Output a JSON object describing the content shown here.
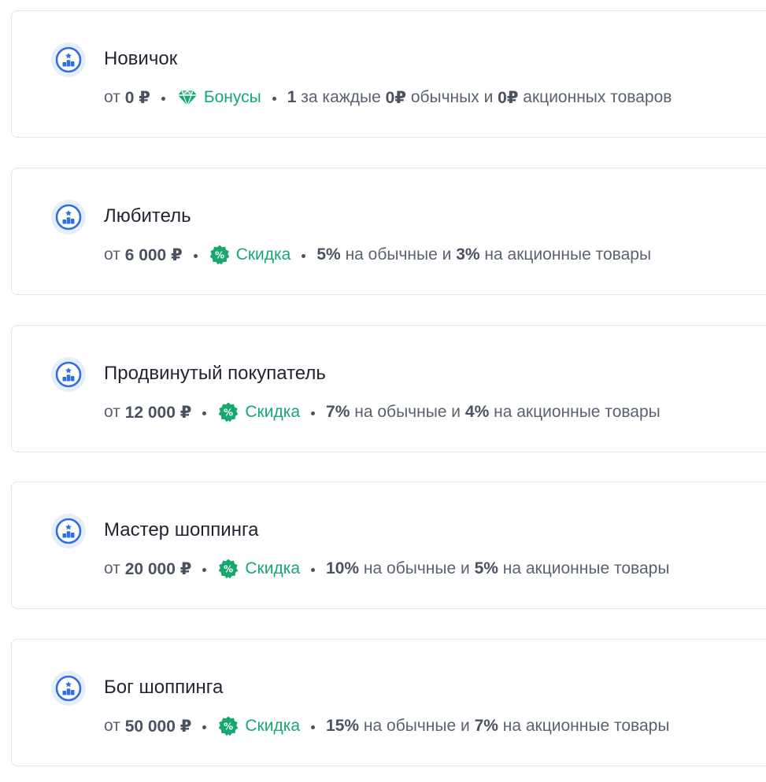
{
  "colors": {
    "accent_green": "#17a86f",
    "icon_blue": "#2f6fe0",
    "icon_bg": "#e6eefc",
    "border": "#e3e5ea"
  },
  "common": {
    "prefix": "от",
    "on_regular": "на обычные и",
    "on_promo": "на акционные товары",
    "bonus_per": "за каждые",
    "bonus_regular": "обычных и",
    "bonus_promo": "акционных товаров"
  },
  "levels": [
    {
      "icon": "level-podium-icon",
      "title": "Новичок",
      "threshold": "0 ₽",
      "benefit_icon": "diamond-icon",
      "benefit_label": "Бонусы",
      "bonus_amount": "1",
      "bonus_regular_sum": "0₽",
      "bonus_promo_sum": "0₽"
    },
    {
      "icon": "level-podium-icon",
      "title": "Любитель",
      "threshold": "6 000 ₽",
      "benefit_icon": "discount-percent-icon",
      "benefit_label": "Скидка",
      "regular_discount": "5%",
      "promo_discount": "3%"
    },
    {
      "icon": "level-podium-icon",
      "title": "Продвинутый покупатель",
      "threshold": "12 000 ₽",
      "benefit_icon": "discount-percent-icon",
      "benefit_label": "Скидка",
      "regular_discount": "7%",
      "promo_discount": "4%"
    },
    {
      "icon": "level-podium-icon",
      "title": "Мастер шоппинга",
      "threshold": "20 000 ₽",
      "benefit_icon": "discount-percent-icon",
      "benefit_label": "Скидка",
      "regular_discount": "10%",
      "promo_discount": "5%"
    },
    {
      "icon": "level-podium-icon",
      "title": "Бог шоппинга",
      "threshold": "50 000 ₽",
      "benefit_icon": "discount-percent-icon",
      "benefit_label": "Скидка",
      "regular_discount": "15%",
      "promo_discount": "7%"
    }
  ]
}
